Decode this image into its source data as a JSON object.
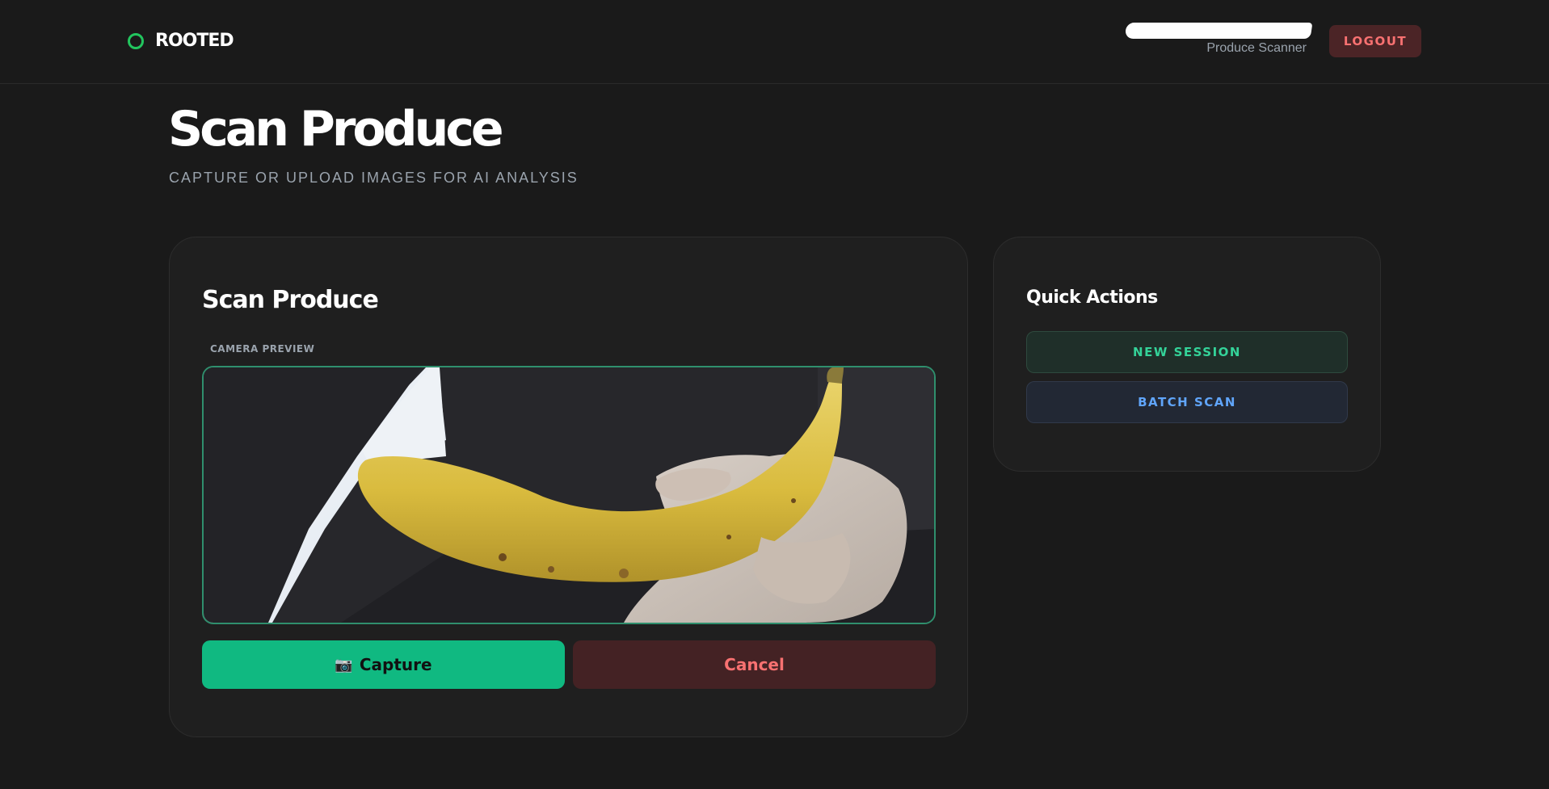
{
  "header": {
    "brand_name": "ROOTED",
    "brand_icon": "status-ring-icon",
    "user_name_redacted": true,
    "user_role": "Produce Scanner",
    "logout_label": "LOGOUT"
  },
  "page": {
    "title": "Scan Produce",
    "subtitle": "CAPTURE OR UPLOAD IMAGES FOR AI ANALYSIS"
  },
  "scan_card": {
    "title": "Scan Produce",
    "preview_label": "CAMERA PREVIEW",
    "preview_subject": "banana held in hand",
    "capture_icon": "📷",
    "capture_label": "Capture",
    "cancel_label": "Cancel"
  },
  "quick_actions": {
    "title": "Quick Actions",
    "items": [
      {
        "label": "NEW SESSION"
      },
      {
        "label": "BATCH SCAN"
      }
    ]
  },
  "colors": {
    "background": "#1a1a1a",
    "card": "#1f1f1f",
    "accent_green": "#10b981",
    "brand_green": "#22c55e",
    "danger_text": "#f87171",
    "danger_bg": "#442224",
    "info_blue": "#60a5fa",
    "muted_text": "#9aa3ad"
  }
}
